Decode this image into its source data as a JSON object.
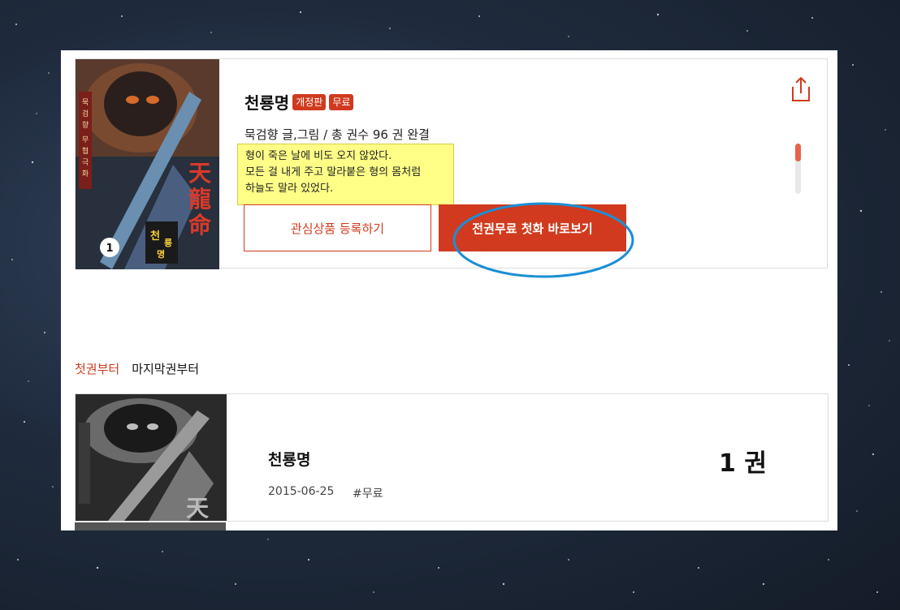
{
  "book": {
    "title": "천룡명",
    "badges": [
      "개정판",
      "무료"
    ],
    "author_line": "묵검향 글,그림 / 총 권수 96 권 완결",
    "description_lines": [
      "형이 죽은 날에 비도 오지 않았다.",
      "모든 걸 내게 주고 말라붙은 형의 몸처럼",
      "하늘도 말라 있었다."
    ],
    "cover_title_hanja": [
      "天",
      "龍",
      "命"
    ],
    "cover_title_hangul": [
      "천",
      "룡",
      "명"
    ],
    "cover_vertical_text": "묵검향 무협극화",
    "cover_volume": "1"
  },
  "actions": {
    "wishlist_label": "관심상품 등록하기",
    "read_free_label": "전권무료 첫화 바로보기"
  },
  "colors": {
    "accent": "#d13a1e",
    "note_bg": "#ffff88",
    "annotation_circle": "#1a8fd6"
  },
  "sort_tabs": {
    "first": "첫권부터",
    "last": "마지막권부터"
  },
  "volumes": [
    {
      "title": "천룡명",
      "date": "2015-06-25",
      "tag": "#무료",
      "volume": "1 권"
    }
  ],
  "icons": {
    "share": "share-icon"
  }
}
